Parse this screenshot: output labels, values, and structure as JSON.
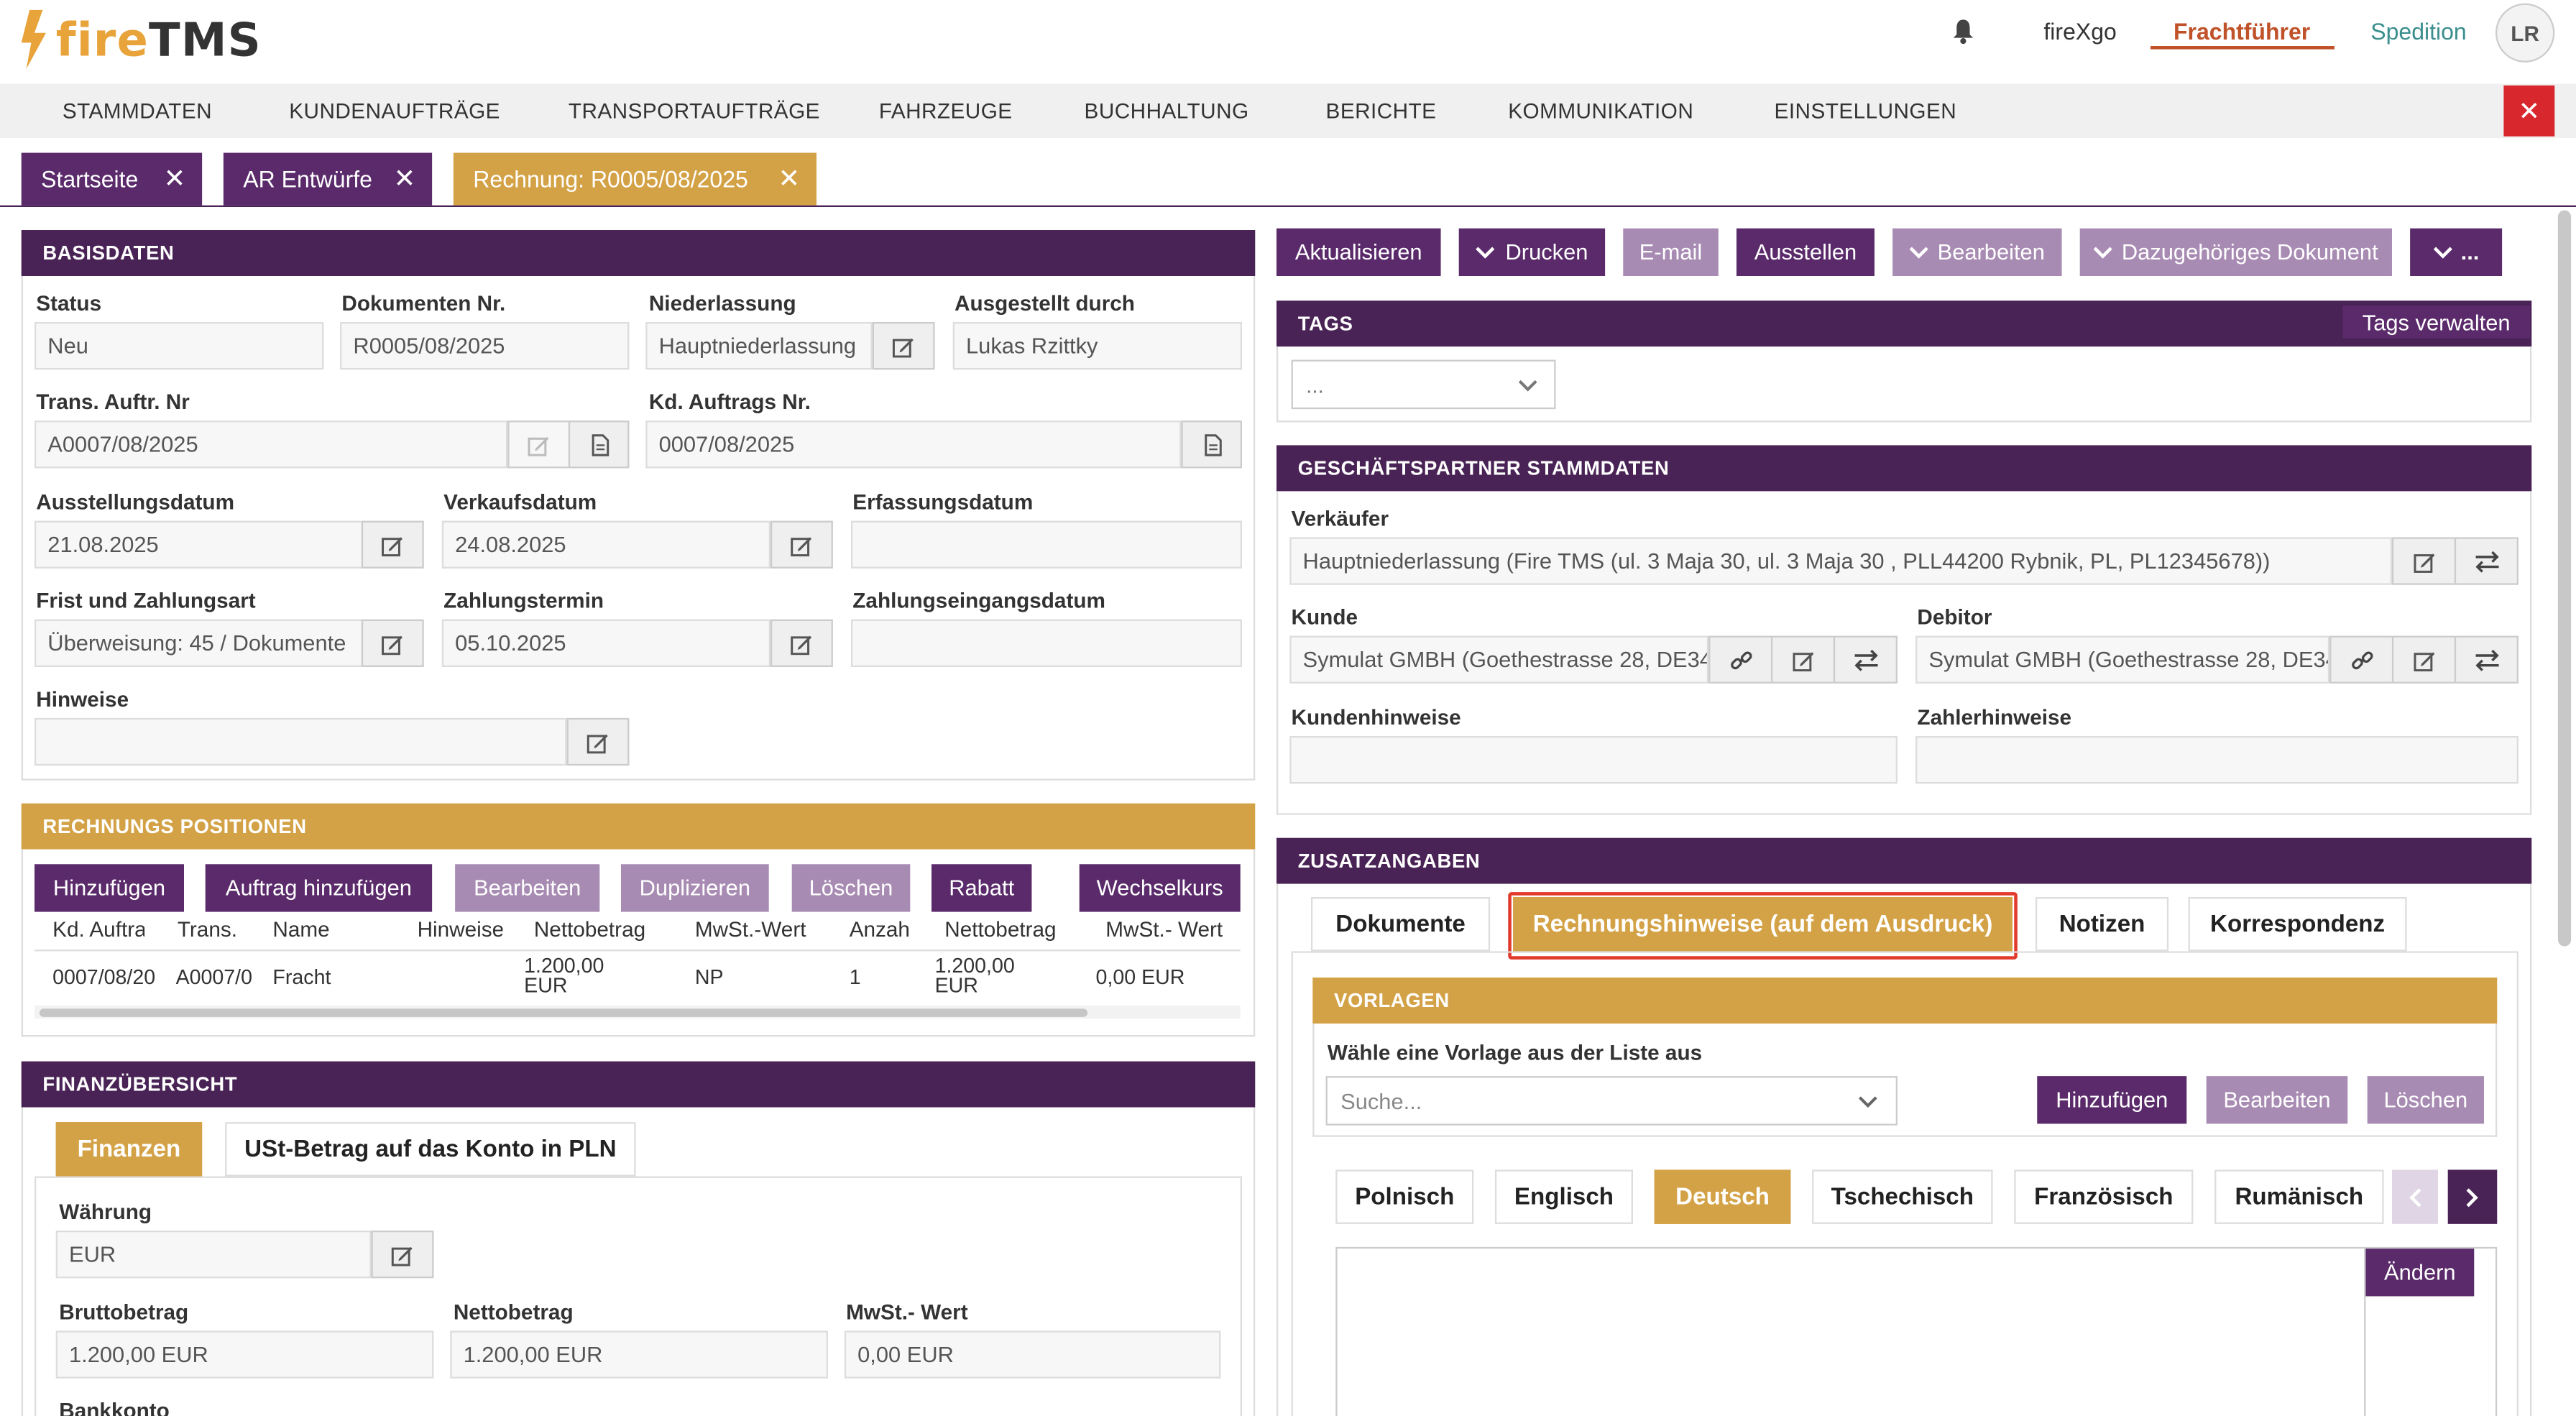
{
  "app": {
    "logo_fire": "fire",
    "logo_tms": "TMS"
  },
  "top_nav": {
    "user": "fireXgo",
    "role_active": "Frachtführer",
    "role_other": "Spedition",
    "avatar": "LR"
  },
  "menu": [
    "STAMMDATEN",
    "KUNDENAUFTRÄGE",
    "TRANSPORTAUFTRÄGE",
    "FAHRZEUGE",
    "BUCHHALTUNG",
    "BERICHTE",
    "KOMMUNIKATION",
    "EINSTELLUNGEN"
  ],
  "tabs": [
    "Startseite",
    "AR Entwürfe",
    "Rechnung: R0005/08/2025"
  ],
  "basisdaten": {
    "title": "BASISDATEN",
    "status_label": "Status",
    "status": "Neu",
    "doknr_label": "Dokumenten Nr.",
    "doknr": "R0005/08/2025",
    "niederlassung_label": "Niederlassung",
    "niederlassung": "Hauptniederlassung",
    "ausgestellt_label": "Ausgestellt durch",
    "ausgestellt": "Lukas Rzittky",
    "trans_label": "Trans. Auftr. Nr",
    "trans": "A0007/08/2025",
    "kd_label": "Kd. Auftrags Nr.",
    "kd": "0007/08/2025",
    "ausst_label": "Ausstellungsdatum",
    "ausst": "21.08.2025",
    "verk_label": "Verkaufsdatum",
    "verk": "24.08.2025",
    "erf_label": "Erfassungsdatum",
    "erf": "",
    "frist_label": "Frist und Zahlungsart",
    "frist": "Überweisung: 45 / Dokumente",
    "ztermin_label": "Zahlungstermin",
    "ztermin": "05.10.2025",
    "zeingang_label": "Zahlungseingangsdatum",
    "zeingang": "",
    "hinweise_label": "Hinweise",
    "hinweise": ""
  },
  "positionen": {
    "title": "RECHNUNGS POSITIONEN",
    "buttons": [
      "Hinzufügen",
      "Auftrag hinzufügen",
      "Bearbeiten",
      "Duplizieren",
      "Löschen",
      "Rabatt",
      "Wechselkurs"
    ],
    "columns": [
      "Kd. Auftra",
      "Trans.",
      "Name",
      "Hinweise",
      "Nettobetrag",
      "MwSt.-Wert",
      "Anzah",
      "Nettobetrag",
      "MwSt.- Wert"
    ],
    "row": [
      "0007/08/20",
      "A0007/0",
      "Fracht",
      "",
      "1.200,00 EUR",
      "NP",
      "1",
      "1.200,00 EUR",
      "0,00 EUR"
    ]
  },
  "finanz": {
    "title": "FINANZÜBERSICHT",
    "tab_active": "Finanzen",
    "tab_other": "USt-Betrag auf das Konto in PLN",
    "waehrung_label": "Währung",
    "waehrung": "EUR",
    "brutto_label": "Bruttobetrag",
    "brutto": "1.200,00 EUR",
    "netto_label": "Nettobetrag",
    "netto": "1.200,00 EUR",
    "mwst_label": "MwSt.- Wert",
    "mwst": "0,00 EUR",
    "bank_label": "Bankkonto"
  },
  "actions": {
    "aktualisieren": "Aktualisieren",
    "drucken": "Drucken",
    "email": "E-mail",
    "ausstellen": "Ausstellen",
    "bearbeiten": "Bearbeiten",
    "dazu": "Dazugehöriges Dokument",
    "more": "..."
  },
  "tags": {
    "title": "TAGS",
    "manage": "Tags verwalten",
    "select": "..."
  },
  "partner": {
    "title": "GESCHÄFTSPARTNER STAMMDATEN",
    "verk_label": "Verkäufer",
    "verk": "Hauptniederlassung (Fire TMS  (ul. 3 Maja 30, ul. 3 Maja 30 , PLL44200 Rybnik, PL, PL12345678))",
    "kunde_label": "Kunde",
    "kunde": "Symulat GMBH (Goethestrasse 28, DE34",
    "debitor_label": "Debitor",
    "debitor": "Symulat GMBH (Goethestrasse 28, DE34",
    "kh_label": "Kundenhinweise",
    "zh_label": "Zahlerhinweise"
  },
  "zusatz": {
    "title": "ZUSATZANGABEN",
    "tabs": [
      "Dokumente",
      "Rechnungshinweise (auf dem Ausdruck)",
      "Notizen",
      "Korrespondenz"
    ],
    "vorlagen_title": "VORLAGEN",
    "vorlage_label": "Wähle eine Vorlage aus der Liste aus",
    "search_placeholder": "Suche...",
    "v_buttons": [
      "Hinzufügen",
      "Bearbeiten",
      "Löschen"
    ],
    "languages": [
      "Polnisch",
      "Englisch",
      "Deutsch",
      "Tschechisch",
      "Französisch",
      "Rumänisch"
    ],
    "aendern": "Ändern"
  },
  "colors": {
    "purple": "#4a2356",
    "button_purple": "#5a2a6b",
    "gold": "#d4a246",
    "red": "#d9272e",
    "accent_orange": "#c0522a"
  }
}
